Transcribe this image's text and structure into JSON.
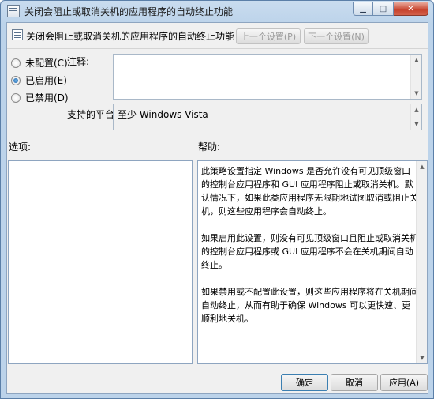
{
  "window": {
    "title": "关闭会阻止或取消关机的应用程序的自动终止功能"
  },
  "header": {
    "policy_title": "关闭会阻止或取消关机的应用程序的自动终止功能",
    "prev_setting_label": "上一个设置(P)",
    "next_setting_label": "下一个设置(N)"
  },
  "options": {
    "not_configured": "未配置(C)",
    "enabled": "已启用(E)",
    "disabled": "已禁用(D)",
    "selected": "enabled"
  },
  "comment": {
    "label": "注释:",
    "value": ""
  },
  "platform": {
    "label": "支持的平台:",
    "value": "至少 Windows Vista"
  },
  "sections": {
    "options_label": "选项:",
    "help_label": "帮助:"
  },
  "help": {
    "paragraphs": [
      "此策略设置指定 Windows 是否允许没有可见顶级窗口的控制台应用程序和 GUI 应用程序阻止或取消关机。默认情况下，如果此类应用程序无限期地试图取消或阻止关机，则这些应用程序会自动终止。",
      "如果启用此设置，则没有可见顶级窗口且阻止或取消关机的控制台应用程序或 GUI 应用程序不会在关机期间自动终止。",
      "如果禁用或不配置此设置，则这些应用程序将在关机期间自动终止，从而有助于确保 Windows 可以更快速、更顺利地关机。"
    ]
  },
  "buttons": {
    "ok": "确定",
    "cancel": "取消",
    "apply": "应用(A)"
  }
}
